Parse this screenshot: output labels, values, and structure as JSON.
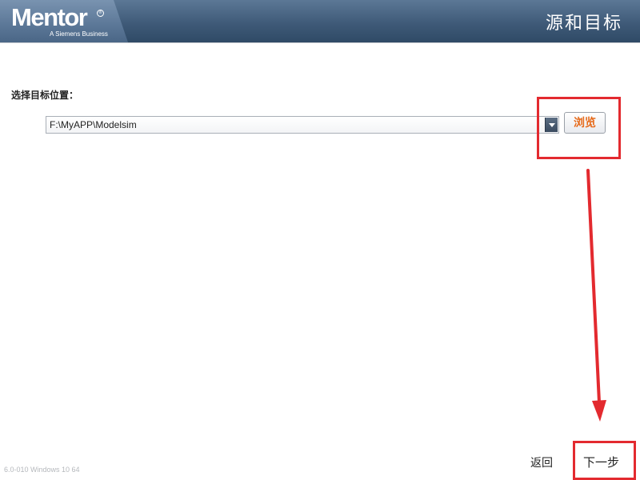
{
  "header": {
    "logo_name": "Mentor",
    "logo_reg": "®",
    "logo_subtitle": "A Siemens Business",
    "title": "源和目标"
  },
  "main": {
    "section_label": "选择目标位置：",
    "path_value": "F:\\MyAPP\\Modelsim",
    "browse_label": "浏览"
  },
  "footer": {
    "version": "6.0-010  Windows 10 64",
    "back_label": "返回",
    "next_label": "下一步"
  },
  "colors": {
    "header_dark": "#2f4a66",
    "header_light": "#7993b0",
    "accent_orange": "#e66a1a",
    "annotation_red": "#e32a2f"
  },
  "icons": {
    "dropdown": "chevron-down-icon"
  }
}
